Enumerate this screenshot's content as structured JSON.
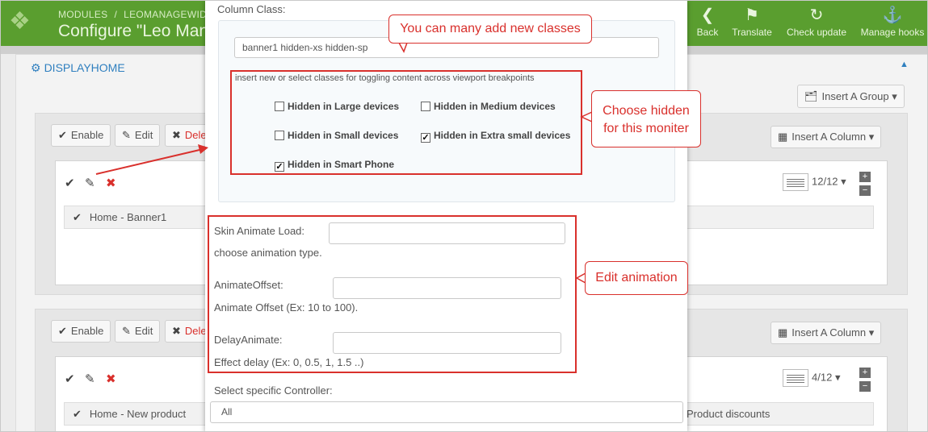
{
  "header": {
    "breadcrumb_module": "MODULES",
    "breadcrumb_sep": "/",
    "breadcrumb_item": "LEOMANAGEWIDG",
    "title": "Configure \"Leo Mana",
    "buttons": [
      {
        "label": "Back",
        "icon": "back-arrow-icon"
      },
      {
        "label": "Translate",
        "icon": "flag-icon"
      },
      {
        "label": "Check update",
        "icon": "refresh-icon"
      },
      {
        "label": "Manage hooks",
        "icon": "anchor-icon"
      }
    ]
  },
  "background": {
    "section_title": "DISPLAYHOME",
    "insert_group": "Insert A Group",
    "groups": [
      {
        "actions": {
          "enable": "Enable",
          "edit": "Edit",
          "delete": "Dele"
        },
        "insert_column": "Insert A Column",
        "column_size": "12/12",
        "rows": [
          "Home - Banner1"
        ]
      },
      {
        "actions": {
          "enable": "Enable",
          "edit": "Edit",
          "delete": "Dele"
        },
        "insert_column": "Insert A Column",
        "column_size": "4/12",
        "rows": [
          "Home - New product",
          "Product discounts"
        ]
      }
    ]
  },
  "modal": {
    "column_class_label": "Column Class:",
    "column_class_value": "banner1 hidden-xs hidden-sp",
    "helper_text": "insert new or select classes for toggling content across viewport breakpoints",
    "checkboxes": [
      {
        "label": "Hidden in Large devices",
        "checked": false
      },
      {
        "label": "Hidden in Medium devices",
        "checked": false
      },
      {
        "label": "Hidden in Small devices",
        "checked": false
      },
      {
        "label": "Hidden in Extra small devices",
        "checked": true
      },
      {
        "label": "Hidden in Smart Phone",
        "checked": true
      }
    ],
    "skin_animate_label": "Skin Animate Load:",
    "skin_animate_help": "choose animation type.",
    "animate_offset_label": "AnimateOffset:",
    "animate_offset_help": "Animate Offset (Ex: 10 to 100).",
    "delay_animate_label": "DelayAnimate:",
    "delay_animate_help": "Effect delay (Ex: 0, 0.5, 1, 1.5 ..)",
    "controller_label": "Select specific Controller:",
    "controller_value": "All"
  },
  "annotations": {
    "add_classes": "You can many add new classes",
    "choose_hidden_line1": "Choose hidden",
    "choose_hidden_line2": "for this moniter",
    "edit_animation": "Edit animation",
    "color": "#d9302c"
  },
  "colors": {
    "header_green": "#5a9e2f",
    "link_blue": "#2f7fbf"
  }
}
